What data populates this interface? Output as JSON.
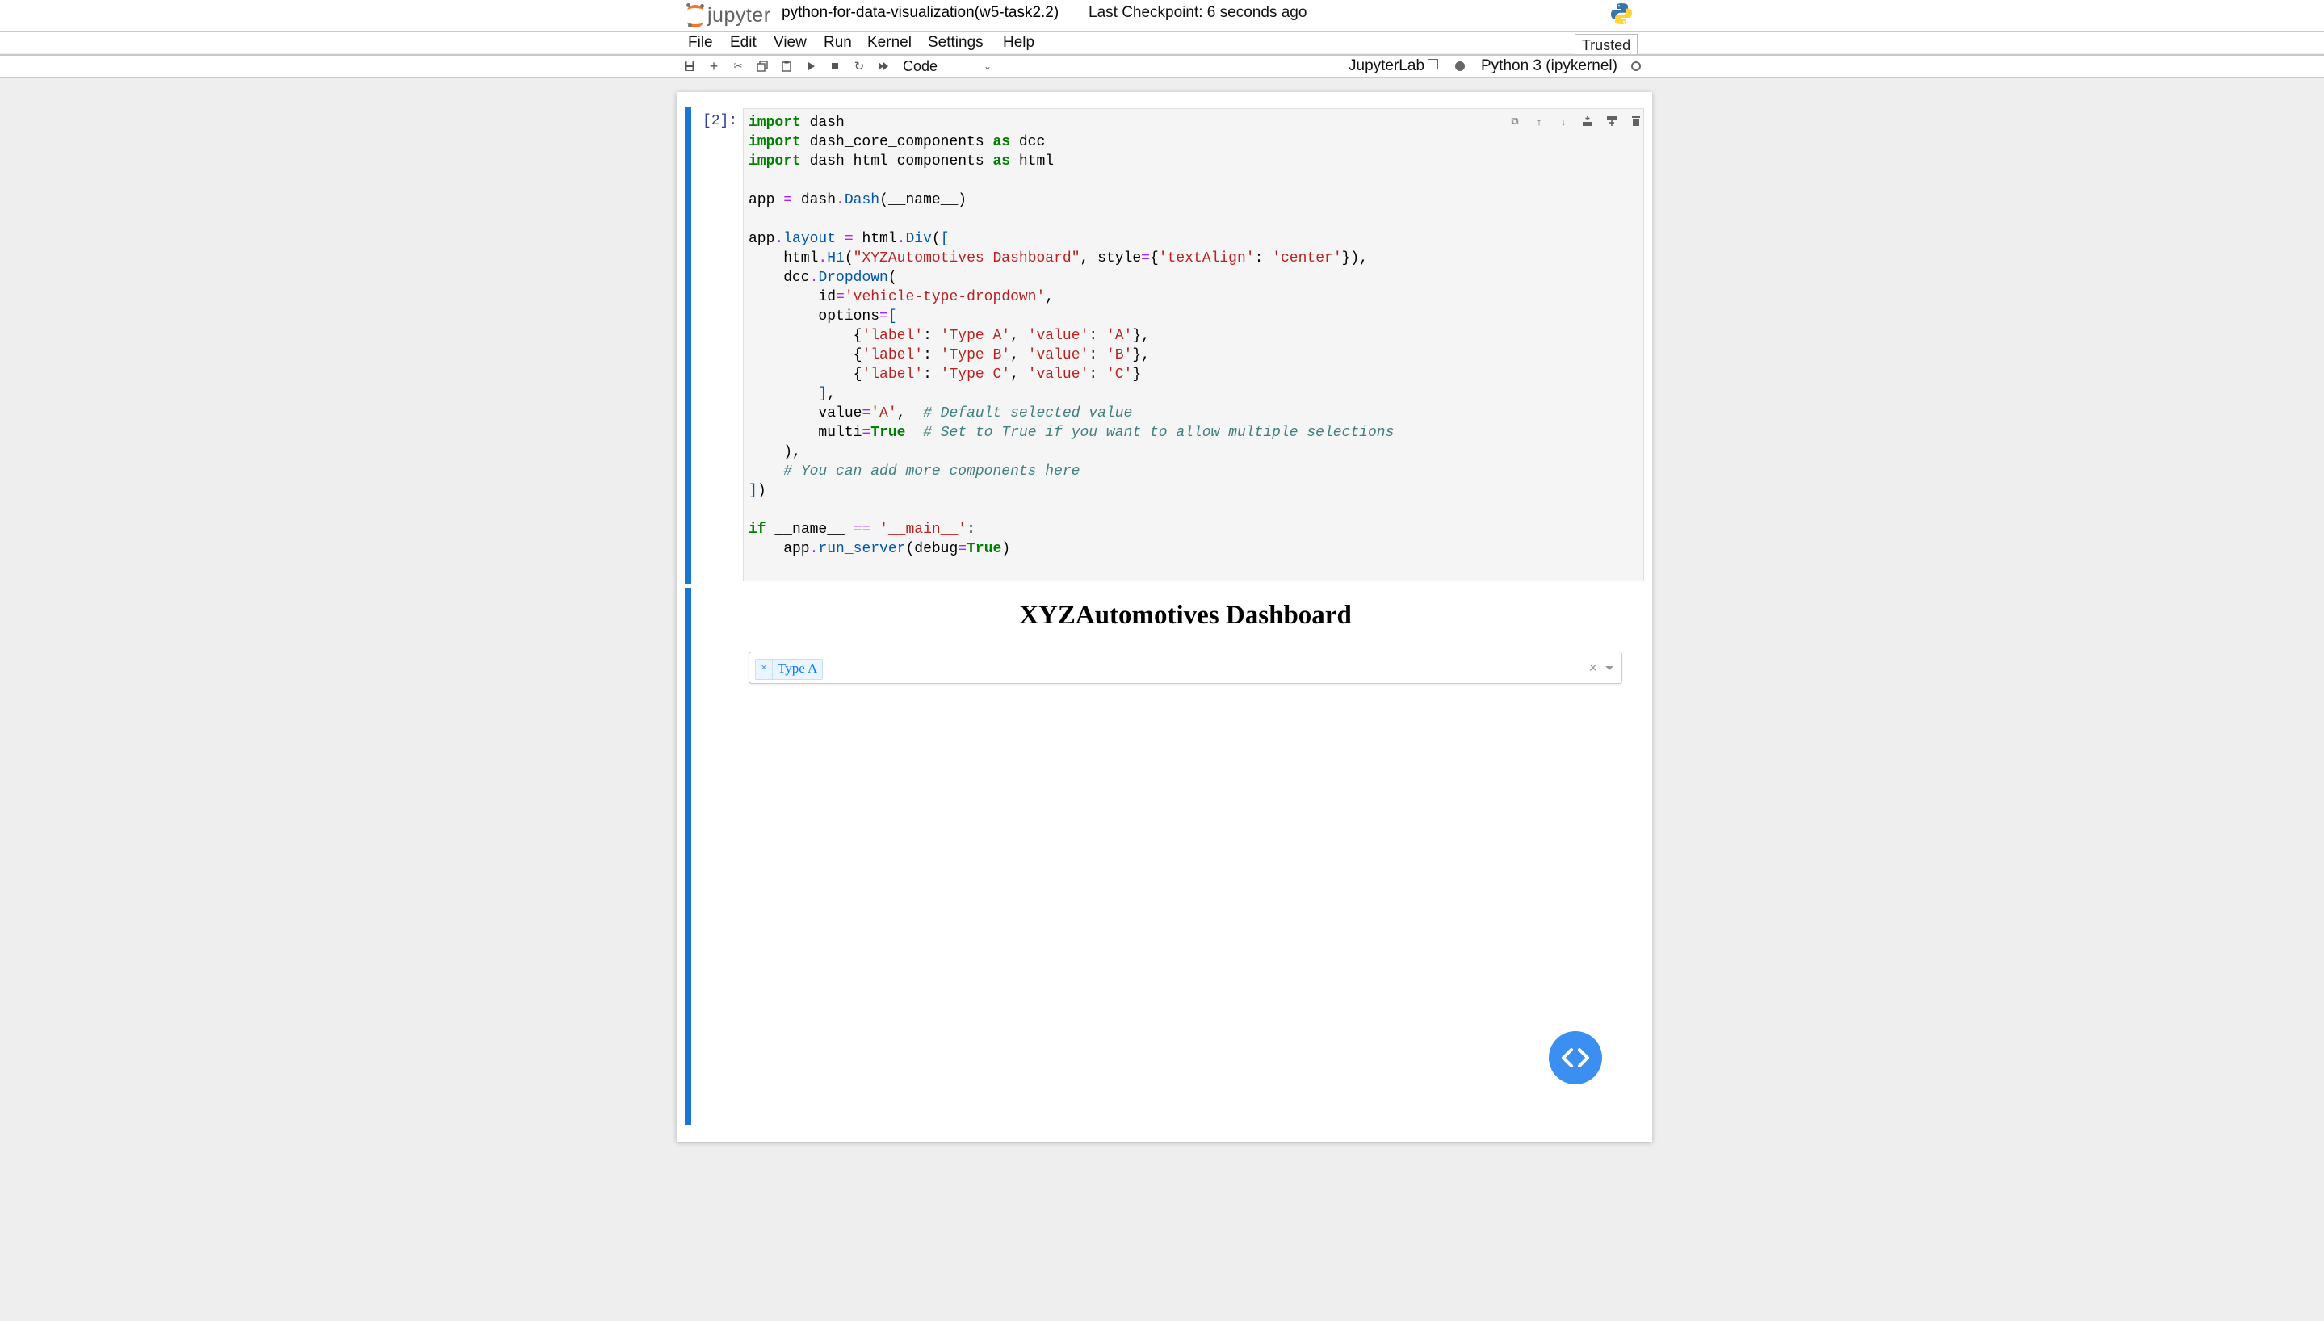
{
  "header": {
    "logo_text": "jupyter",
    "notebook_name": "python-for-data-visualization(w5-task2.2)",
    "checkpoint": "Last Checkpoint: 6 seconds ago",
    "trusted": "Trusted"
  },
  "menu": {
    "items": [
      "File",
      "Edit",
      "View",
      "Run",
      "Kernel",
      "Settings",
      "Help"
    ]
  },
  "toolbar": {
    "icons": [
      "save-icon",
      "add-cell-icon",
      "cut-icon",
      "copy-icon",
      "paste-icon",
      "run-icon",
      "stop-icon",
      "restart-icon",
      "fast-forward-icon"
    ],
    "cell_type": "Code",
    "jupyterlab_label": "JupyterLab",
    "kernel_name": "Python 3 (ipykernel)"
  },
  "cell": {
    "prompt": "[2]:",
    "toolbar_icons": [
      "duplicate-icon",
      "move-up-icon",
      "move-down-icon",
      "insert-below-icon",
      "merge-icon",
      "delete-icon"
    ]
  },
  "output": {
    "title": "XYZAutomotives Dashboard",
    "dropdown": {
      "selected": "Type A",
      "remove_glyph": "×",
      "clear_glyph": "×"
    },
    "devtools_icon": "code-brackets-icon"
  },
  "colors": {
    "accent": "#1976d2",
    "chip_text": "#007eff",
    "devtools": "#3b8ff0"
  }
}
